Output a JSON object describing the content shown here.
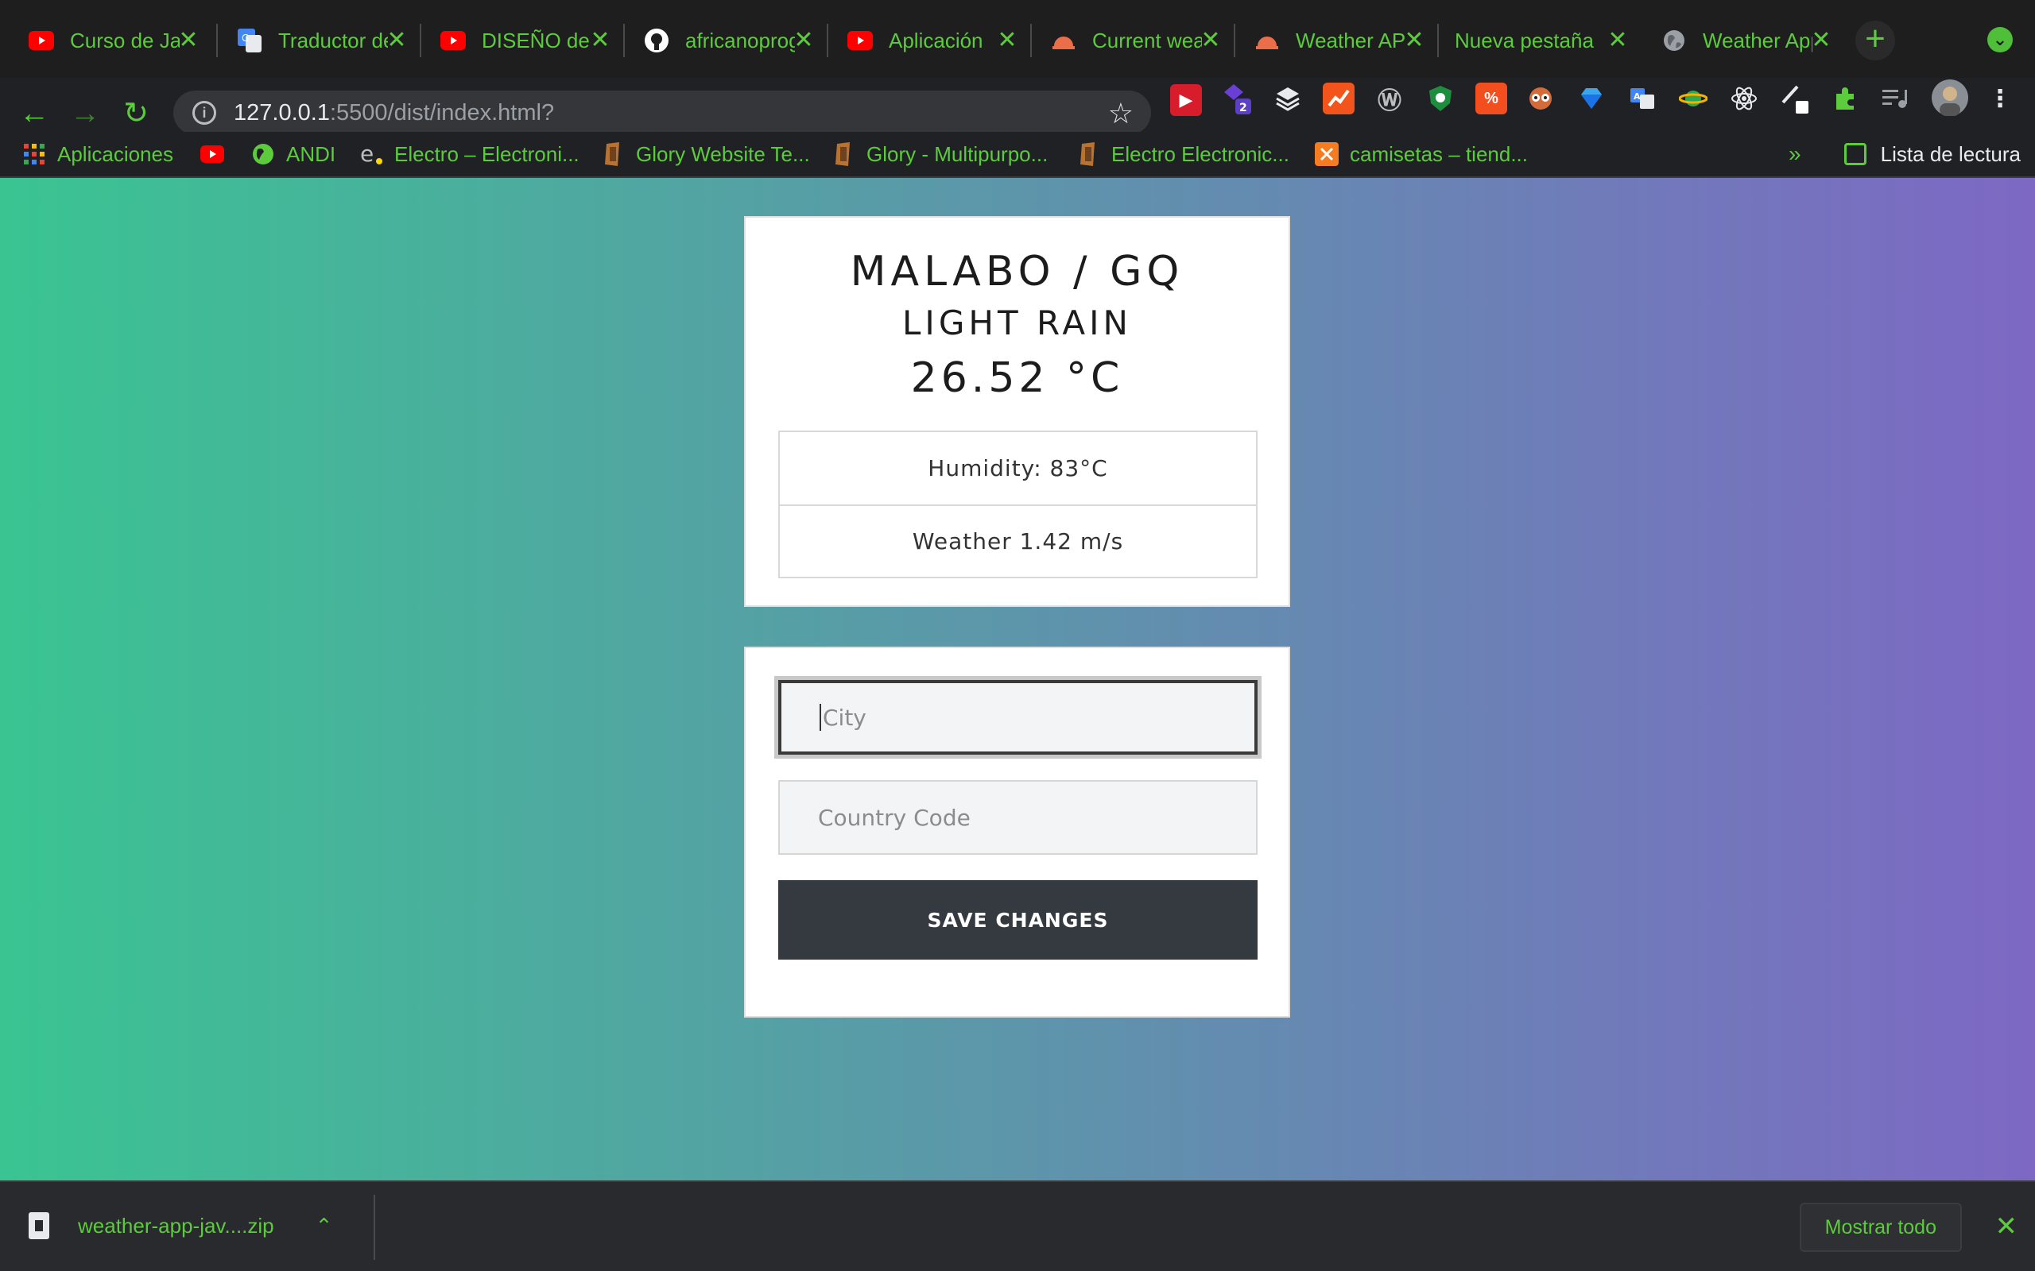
{
  "browser": {
    "tabs": [
      {
        "label": "Curso de JavaScript",
        "icon": "youtube-icon"
      },
      {
        "label": "Traductor de Google",
        "icon": "google-translate-icon"
      },
      {
        "label": "DISEÑO de",
        "icon": "youtube-icon"
      },
      {
        "label": "africanoprogramador",
        "icon": "github-icon"
      },
      {
        "label": "Aplicación",
        "icon": "youtube-icon"
      },
      {
        "label": "Current weather",
        "icon": "openweather-icon"
      },
      {
        "label": "Weather API",
        "icon": "openweather-icon"
      },
      {
        "label": "Nueva pestaña",
        "icon": ""
      },
      {
        "label": "Weather App",
        "icon": "globe-icon"
      }
    ],
    "address": {
      "host": "127.0.0.1",
      "rest": ":5500/dist/index.html?"
    },
    "bookmarks": [
      {
        "label": "Aplicaciones",
        "icon": "apps-grid-icon"
      },
      {
        "label": "",
        "icon": "youtube-icon"
      },
      {
        "label": "ANDI",
        "icon": "globe-icon"
      },
      {
        "label": "Electro – Electroni...",
        "icon": "e-logo-icon"
      },
      {
        "label": "Glory Website Te...",
        "icon": "glory-icon"
      },
      {
        "label": "Glory - Multipurpo...",
        "icon": "glory-icon"
      },
      {
        "label": "Electro Electronic...",
        "icon": "glory-icon"
      },
      {
        "label": "camisetas – tiend...",
        "icon": "xampp-icon"
      }
    ],
    "reading_list": "Lista de lectura",
    "more_chevron": "»"
  },
  "weather": {
    "location": "MALABO / GQ",
    "description": "LIGHT RAIN",
    "temperature": "26.52 °C",
    "humidity": "Humidity: 83°C",
    "wind": "Weather 1.42 m/s"
  },
  "form": {
    "city_placeholder": "City",
    "country_placeholder": "Country Code",
    "save_label": "SAVE CHANGES"
  },
  "downloads": {
    "file_name": "weather-app-jav....zip",
    "show_all": "Mostrar todo"
  },
  "colors": {
    "accent": "#5ccb3c",
    "gradient_start": "#3ac492",
    "gradient_end": "#7d68c4",
    "button": "#343a40"
  }
}
